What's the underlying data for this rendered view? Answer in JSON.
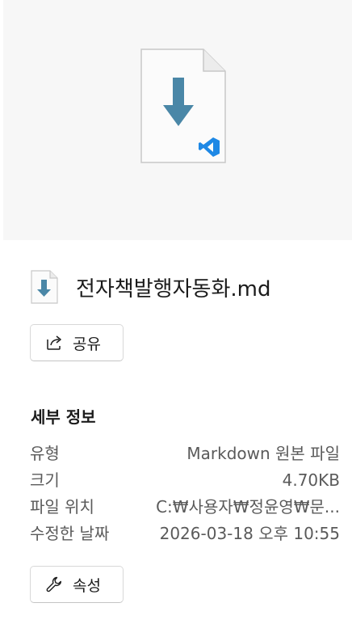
{
  "file": {
    "name": "전자책발행자동화.md"
  },
  "share_button": {
    "label": "공유"
  },
  "details": {
    "title": "세부 정보",
    "rows": [
      {
        "label": "유형",
        "value": "Markdown 원본 파일"
      },
      {
        "label": "크기",
        "value": "4.70KB"
      },
      {
        "label": "파일 위치",
        "value": "C:₩사용자₩정윤영₩문..."
      },
      {
        "label": "수정한 날짜",
        "value": "2026-03-18 오후 10:55"
      }
    ]
  },
  "properties_button": {
    "label": "속성"
  },
  "colors": {
    "preview_bg": "#f7f7f7",
    "download_arrow": "#4a87a7",
    "vscode_blue": "#1e88e5"
  },
  "icons": {
    "preview": "markdown-file-vscode-icon",
    "file": "download-file-icon",
    "share": "share-icon",
    "properties": "wrench-icon"
  }
}
